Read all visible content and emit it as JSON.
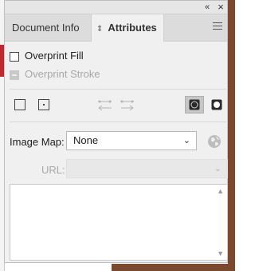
{
  "titlebar": {
    "collapse_glyph": "«",
    "close_glyph": "×"
  },
  "tabs": [
    {
      "label": "Document Info"
    },
    {
      "label": "Attributes",
      "sort_glyph": "⇕"
    }
  ],
  "overprint": {
    "fill_label": "Overprint Fill",
    "stroke_label": "Overprint Stroke"
  },
  "image_map": {
    "label": "Image Map:",
    "value": "None"
  },
  "url": {
    "label": "URL:",
    "value": ""
  },
  "notes": {
    "value": ""
  },
  "colors": {
    "panel_bg": "#f0f0f0",
    "tab_bar_bg": "#dcdcdc",
    "disabled_text": "#a8a8a8",
    "pressed_button": "#c6c6c6"
  },
  "icons": [
    "collapse-icon",
    "close-icon",
    "panel-menu-icon",
    "dont-show-center-icon",
    "show-center-icon",
    "reverse-path-direction-off-icon",
    "reverse-path-direction-on-icon",
    "use-non-zero-winding-fill-rule-icon",
    "use-even-odd-fill-rule-icon",
    "browser-globe-icon"
  ]
}
